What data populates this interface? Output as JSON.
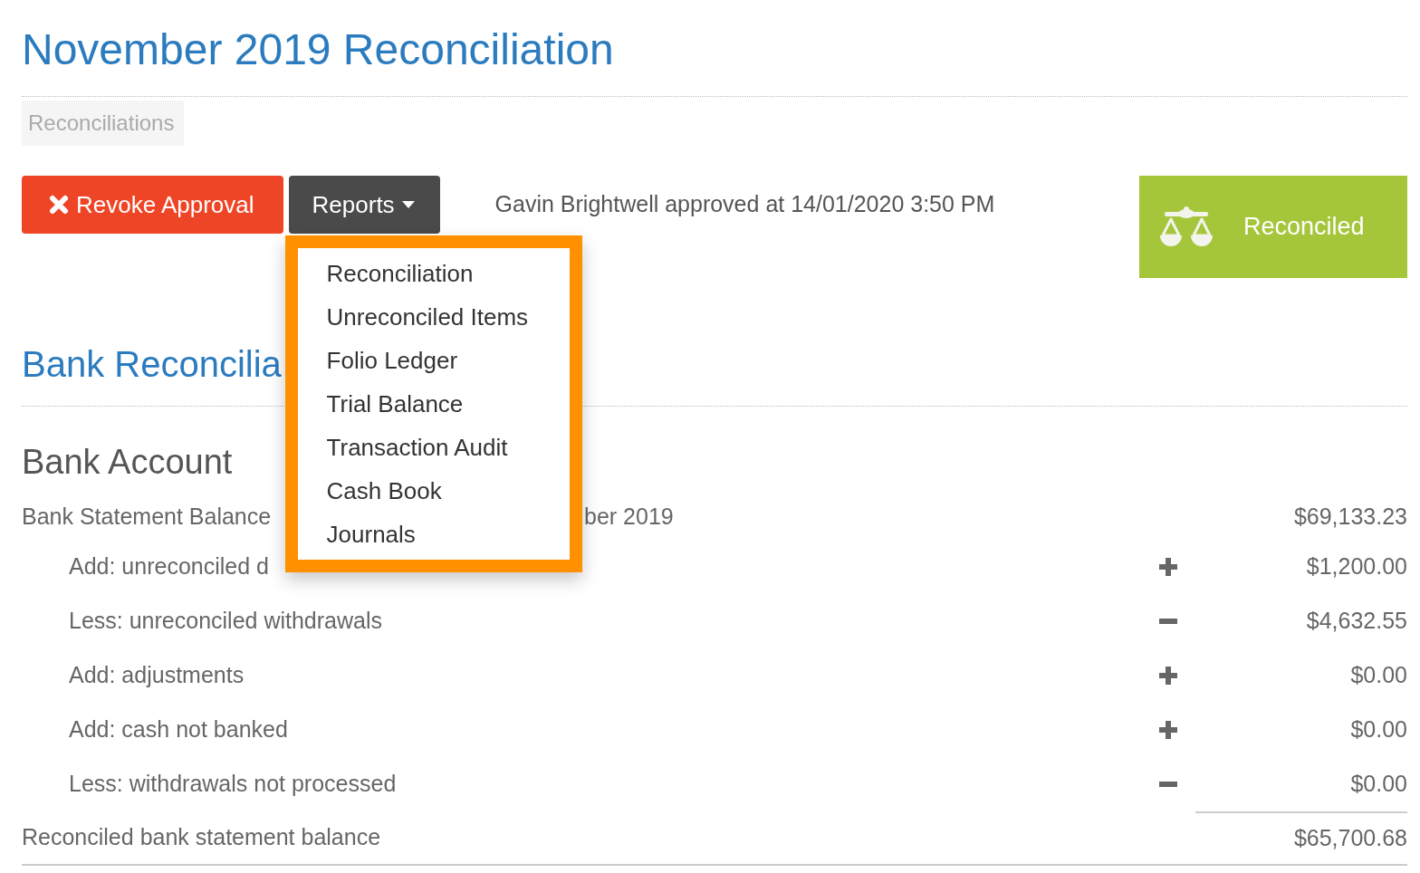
{
  "page": {
    "title": "November 2019 Reconciliation"
  },
  "breadcrumbs": [
    {
      "label": "Reconciliations"
    }
  ],
  "toolbar": {
    "buttons": [
      {
        "kind": "revoke",
        "label": "Revoke Approval"
      },
      {
        "kind": "menu",
        "label": "Reports"
      }
    ],
    "approval_note": "Gavin Brightwell approved at 14/01/2020 3:50 PM"
  },
  "reports_menu": {
    "open": true,
    "items": [
      {
        "label": "Reconciliation"
      },
      {
        "label": "Unreconciled Items"
      },
      {
        "label": "Folio Ledger"
      },
      {
        "label": "Trial Balance"
      },
      {
        "label": "Transaction Audit"
      },
      {
        "label": "Cash Book"
      },
      {
        "label": "Journals"
      }
    ]
  },
  "status_badge": {
    "label": "Reconciled"
  },
  "section": {
    "title": "Bank Reconcilia"
  },
  "bank_account": {
    "title": "Bank Account",
    "statement_balance": {
      "label": "Bank Statement Balance",
      "label_tail": "ber 2019",
      "amount": "$69,133.23"
    },
    "adjustments": [
      {
        "kind": "plus",
        "label": "Add: unreconciled d",
        "amount": "$1,200.00"
      },
      {
        "kind": "minus",
        "label": "Less: unreconciled withdrawals",
        "amount": "$4,632.55"
      },
      {
        "kind": "plus",
        "label": "Add: adjustments",
        "amount": "$0.00"
      },
      {
        "kind": "plus",
        "label": "Add: cash not banked",
        "amount": "$0.00"
      },
      {
        "kind": "minus",
        "label": "Less: withdrawals not processed",
        "amount": "$0.00"
      }
    ],
    "total": {
      "label": "Reconciled bank statement balance",
      "amount": "$65,700.68"
    }
  }
}
